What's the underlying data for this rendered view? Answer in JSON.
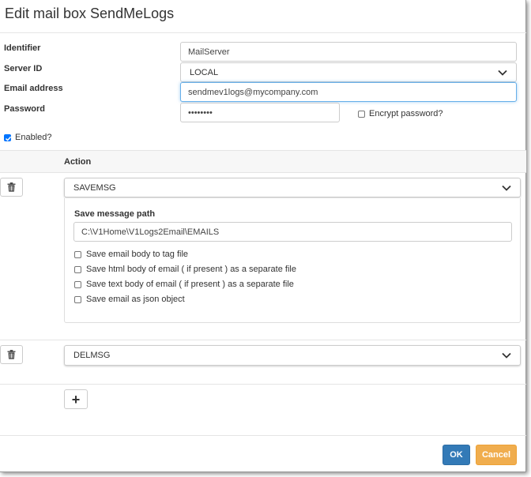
{
  "dialog": {
    "title": "Edit mail box SendMeLogs"
  },
  "form": {
    "identifier_label": "Identifier",
    "identifier_value": "MailServer",
    "server_id_label": "Server ID",
    "server_id_value": "LOCAL",
    "email_label": "Email address",
    "email_value": "sendmev1logs@mycompany.com",
    "password_label": "Password",
    "password_value": "••••••••",
    "encrypt_label": "Encrypt password?",
    "encrypt_checked": false,
    "enabled_label": "Enabled?",
    "enabled_checked": true
  },
  "actions": {
    "header": "Action",
    "items": [
      {
        "value": "SAVEMSG",
        "save_path_label": "Save message path",
        "save_path_value": "C:\\V1Home\\V1Logs2Email\\EMAILS",
        "options": [
          "Save email body to tag file",
          "Save html body of email ( if present ) as a separate file",
          "Save text body of email ( if present ) as a separate file",
          "Save email as json object"
        ]
      },
      {
        "value": "DELMSG"
      }
    ],
    "add_label": "+"
  },
  "footer": {
    "ok_label": "OK",
    "cancel_label": "Cancel"
  },
  "colors": {
    "primary": "#337ab7",
    "warning": "#f0ad4e",
    "checkbox": "#0075ff"
  }
}
